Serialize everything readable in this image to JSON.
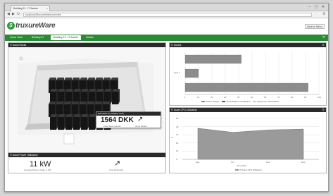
{
  "browser": {
    "tab_title": "Building 01 - IT Assets",
    "tab_close": "×",
    "window_controls": "–  ▢  ✕",
    "url": "localhost/StruxureWare/overview",
    "back": "◀",
    "forward": "▶",
    "reload": "↻",
    "menu": "≡"
  },
  "app": {
    "logo_letter": "S",
    "logo_name": "truxureWare",
    "help_button": "Back to Menu"
  },
  "nav": {
    "items": [
      {
        "label": "Home View",
        "active": false
      },
      {
        "label": "Building 01",
        "active": false
      },
      {
        "label": "Building 01 - IT Assets",
        "active": true
      },
      {
        "label": "Details",
        "active": false
      }
    ],
    "close": "✕"
  },
  "panels": {
    "room": {
      "title": "IT Asset Racks",
      "popup": {
        "title": "Estimated Cumulative costs",
        "value": "1564 DKK",
        "subtitle": "Total latest quarter",
        "link": "show details",
        "arrow": "↗"
      }
    },
    "power": {
      "title": "IT Asset Power Utilization",
      "value": "11 kW",
      "subtitle": "Average Power Usage in kW",
      "link": "view full details",
      "arrow": "↗"
    },
    "assets": {
      "title": "IT Assets",
      "icon": "⚙"
    },
    "cpu": {
      "title": "IT Asset CPU Utilization",
      "icon": "⚙"
    }
  },
  "chart_data": [
    {
      "type": "bar",
      "orientation": "horizontal",
      "title": "IT Assets",
      "categories": [
        "",
        "Row 4",
        ""
      ],
      "series": [
        {
          "name": "Total IT Assets",
          "values": [
            42,
            10,
            92
          ],
          "color": "#8c8c8c"
        },
        {
          "name": "Consolidation Candidates",
          "values": [
            0,
            0,
            0
          ],
          "color": "#5a5a5a"
        },
        {
          "name": "Retirement Candidates",
          "values": [
            0,
            0,
            0
          ],
          "color": "#c9c9c9"
        }
      ],
      "xlim": [
        0,
        100
      ],
      "xticks": [
        "0",
        "10",
        "20",
        "30",
        "40",
        "50",
        "60",
        "70",
        "80",
        "90",
        "100"
      ],
      "grid": true,
      "legend_position": "bottom"
    },
    {
      "type": "area",
      "title": "IT Asset CPU Utilization",
      "categories": [
        "Sep",
        "Oct",
        "Nov",
        "Dec"
      ],
      "series": [
        {
          "name": "IT Asset CPU Utilization",
          "values": [
            38,
            33,
            36,
            37
          ],
          "color": "#9a9a9a"
        }
      ],
      "ylim": [
        0,
        50
      ],
      "yticks": [
        "0",
        "10",
        "20",
        "30",
        "40",
        "50"
      ],
      "ylabel": "%",
      "xlabel": "Dec 2014",
      "grid": true,
      "legend_position": "bottom"
    }
  ]
}
